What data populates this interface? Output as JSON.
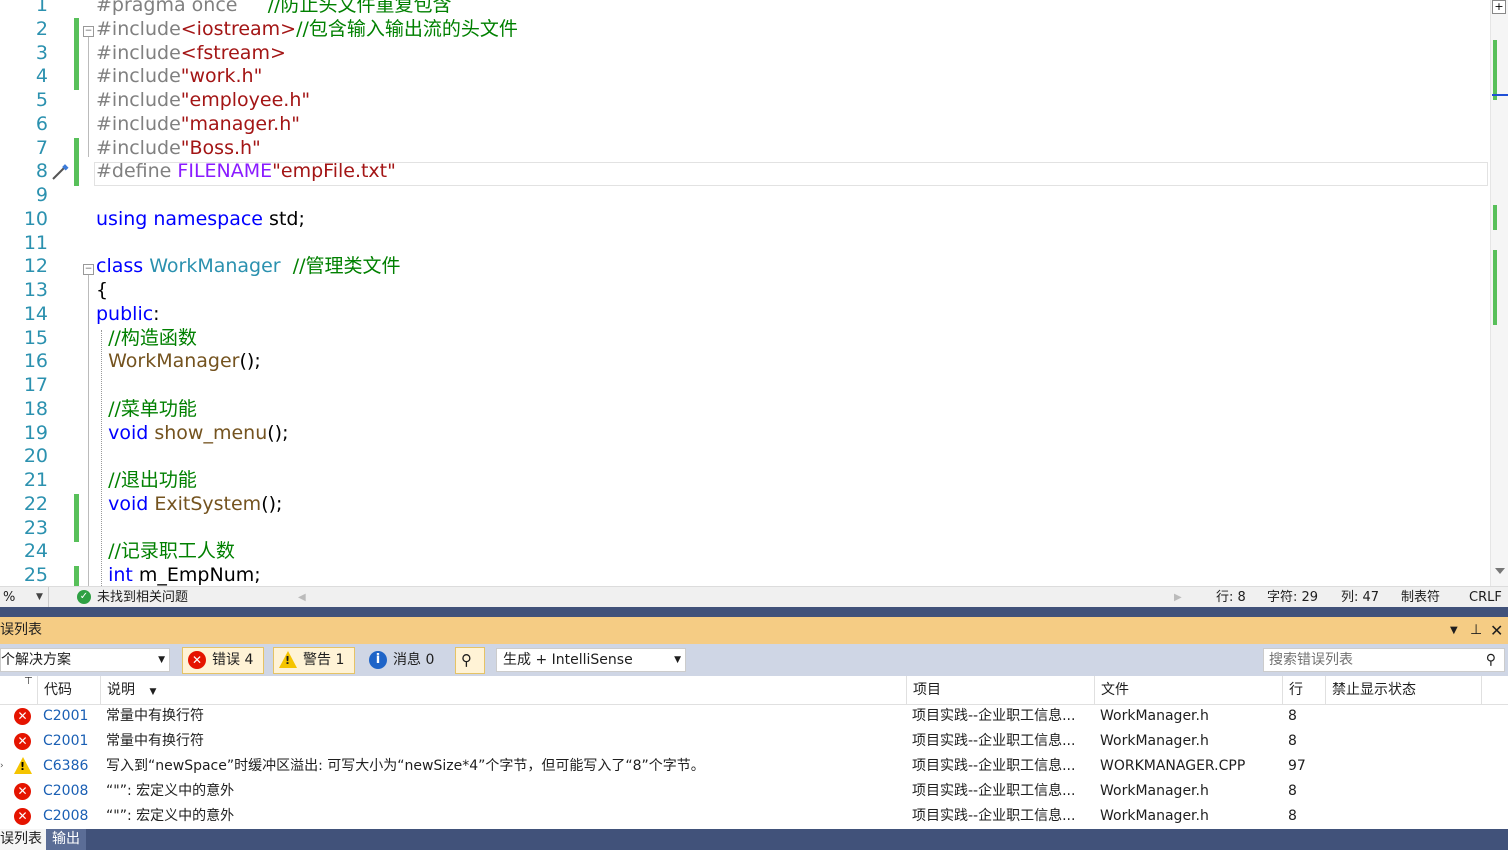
{
  "editor": {
    "lines": [
      {
        "n": "1",
        "segs": [
          [
            "pp",
            "#pragma once"
          ],
          [
            "",
            "     "
          ],
          [
            "cm",
            "//防止头文件重复包含"
          ]
        ]
      },
      {
        "n": "2",
        "segs": [
          [
            "pp",
            "#include"
          ],
          [
            "str",
            "<iostream>"
          ],
          [
            "cm",
            "//包含输入输出流的头文件"
          ]
        ]
      },
      {
        "n": "3",
        "segs": [
          [
            "pp",
            "#include"
          ],
          [
            "str",
            "<fstream>"
          ]
        ]
      },
      {
        "n": "4",
        "segs": [
          [
            "pp",
            "#include"
          ],
          [
            "str",
            "\"work.h\""
          ]
        ]
      },
      {
        "n": "5",
        "segs": [
          [
            "pp",
            "#include"
          ],
          [
            "str",
            "\"employee.h\""
          ]
        ]
      },
      {
        "n": "6",
        "segs": [
          [
            "pp",
            "#include"
          ],
          [
            "str",
            "\"manager.h\""
          ]
        ]
      },
      {
        "n": "7",
        "segs": [
          [
            "pp",
            "#include"
          ],
          [
            "str",
            "\"Boss.h\""
          ]
        ]
      },
      {
        "n": "8",
        "segs": [
          [
            "pp",
            "#define "
          ],
          [
            "mac",
            "FILENAME"
          ],
          [
            "str",
            "\"empFile.txt\""
          ]
        ]
      },
      {
        "n": "9",
        "segs": []
      },
      {
        "n": "10",
        "segs": [
          [
            "kw",
            "using"
          ],
          [
            "",
            " "
          ],
          [
            "kw",
            "namespace"
          ],
          [
            "",
            " std;"
          ]
        ]
      },
      {
        "n": "11",
        "segs": []
      },
      {
        "n": "12",
        "segs": [
          [
            "kw",
            "class"
          ],
          [
            "",
            " "
          ],
          [
            "ty",
            "WorkManager"
          ],
          [
            "",
            "  "
          ],
          [
            "cm",
            "//管理类文件"
          ]
        ]
      },
      {
        "n": "13",
        "segs": [
          [
            "",
            "{"
          ]
        ]
      },
      {
        "n": "14",
        "segs": [
          [
            "kw",
            "public"
          ],
          [
            "",
            ":"
          ]
        ]
      },
      {
        "n": "15",
        "segs": [
          [
            "",
            "  "
          ],
          [
            "cm",
            "//构造函数"
          ]
        ]
      },
      {
        "n": "16",
        "segs": [
          [
            "",
            "  "
          ],
          [
            "fn",
            "WorkManager"
          ],
          [
            "",
            "();"
          ]
        ]
      },
      {
        "n": "17",
        "segs": []
      },
      {
        "n": "18",
        "segs": [
          [
            "",
            "  "
          ],
          [
            "cm",
            "//菜单功能"
          ]
        ]
      },
      {
        "n": "19",
        "segs": [
          [
            "",
            "  "
          ],
          [
            "kw",
            "void"
          ],
          [
            "",
            " "
          ],
          [
            "fn",
            "show_menu"
          ],
          [
            "",
            "();"
          ]
        ]
      },
      {
        "n": "20",
        "segs": []
      },
      {
        "n": "21",
        "segs": [
          [
            "",
            "  "
          ],
          [
            "cm",
            "//退出功能"
          ]
        ]
      },
      {
        "n": "22",
        "segs": [
          [
            "",
            "  "
          ],
          [
            "kw",
            "void"
          ],
          [
            "",
            " "
          ],
          [
            "fn",
            "ExitSystem"
          ],
          [
            "",
            "();"
          ]
        ]
      },
      {
        "n": "23",
        "segs": []
      },
      {
        "n": "24",
        "segs": [
          [
            "",
            "  "
          ],
          [
            "cm",
            "//记录职工人数"
          ]
        ]
      },
      {
        "n": "25",
        "segs": [
          [
            "",
            "  "
          ],
          [
            "kw",
            "int"
          ],
          [
            "",
            " m_EmpNum;"
          ]
        ]
      }
    ]
  },
  "editor_status": {
    "zoom": "%",
    "issues": "未找到相关问题",
    "line": "行: 8",
    "char": "字符: 29",
    "col": "列: 47",
    "tabs": "制表符",
    "eol": "CRLF"
  },
  "error_list": {
    "title": "误列表",
    "scope": "个解决方案",
    "errors_btn": "错误 4",
    "warnings_btn": "警告 1",
    "messages_btn": "消息 0",
    "source": "生成 + IntelliSense",
    "search_placeholder": "搜索错误列表",
    "columns": {
      "code": "代码",
      "desc": "说明",
      "project": "项目",
      "file": "文件",
      "line": "行",
      "suppress": "禁止显示状态"
    },
    "rows": [
      {
        "sev": "error",
        "code": "C2001",
        "desc": "常量中有换行符",
        "project": "项目实践--企业职工信息...",
        "file": "WorkManager.h",
        "line": "8"
      },
      {
        "sev": "error",
        "code": "C2001",
        "desc": "常量中有换行符",
        "project": "项目实践--企业职工信息...",
        "file": "WorkManager.h",
        "line": "8"
      },
      {
        "sev": "warning",
        "code": "C6386",
        "desc": "写入到“newSpace”时缓冲区溢出: 可写大小为“newSize*4”个字节，但可能写入了“8”个字节。",
        "project": "项目实践--企业职工信息...",
        "file": "WORKMANAGER.CPP",
        "line": "97"
      },
      {
        "sev": "error",
        "code": "C2008",
        "desc": "“\"”: 宏定义中的意外",
        "project": "项目实践--企业职工信息...",
        "file": "WorkManager.h",
        "line": "8"
      },
      {
        "sev": "error",
        "code": "C2008",
        "desc": "“\"”: 宏定义中的意外",
        "project": "项目实践--企业职工信息...",
        "file": "WorkManager.h",
        "line": "8"
      }
    ]
  },
  "bottom_tabs": [
    "误列表",
    "输出"
  ]
}
